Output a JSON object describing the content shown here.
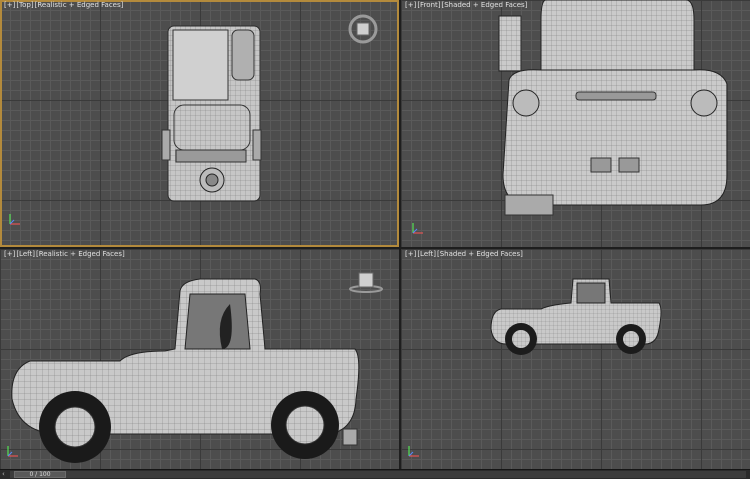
{
  "viewports": {
    "top": {
      "bracket": "[+]",
      "view": "[Top]",
      "shading": "[Realistic + Edged Faces]",
      "cube_label": "TOP"
    },
    "front": {
      "bracket": "[+]",
      "view": "[Front]",
      "shading": "[Shaded + Edged Faces]"
    },
    "left": {
      "bracket": "[+]",
      "view": "[Left]",
      "shading": "[Realistic + Edged Faces]",
      "cube_label": "LEFT"
    },
    "left2": {
      "bracket": "[+]",
      "view": "[Left]",
      "shading": "[Shaded + Edged Faces]"
    }
  },
  "timeline": {
    "frame_label": "0 / 100",
    "prev_icon": "chevron-left-icon"
  },
  "colors": {
    "viewport_bg": "#4d4d4d",
    "active_border": "#b38a3c",
    "model": "#c8c8c8",
    "wire": "#7a7a7a"
  }
}
